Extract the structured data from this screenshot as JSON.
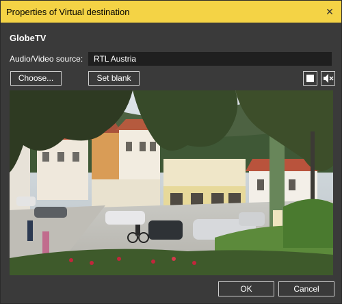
{
  "window": {
    "title": "Properties of Virtual destination",
    "close_glyph": "✕"
  },
  "destination": {
    "name": "GlobeTV"
  },
  "source": {
    "label": "Audio/Video source:",
    "value": "RTL Austria"
  },
  "buttons": {
    "choose": "Choose...",
    "set_blank": "Set blank",
    "ok": "OK",
    "cancel": "Cancel"
  },
  "icons": {
    "stop": "stop-icon",
    "mute": "speaker-mute-icon",
    "close": "close-icon"
  },
  "colors": {
    "titlebar": "#f4d345",
    "dialog_bg": "#3a3a3a",
    "field_bg": "#1f1f1f",
    "button_border": "#cfcfcf"
  },
  "preview": {
    "description_key": "video-preview-street-scene"
  }
}
